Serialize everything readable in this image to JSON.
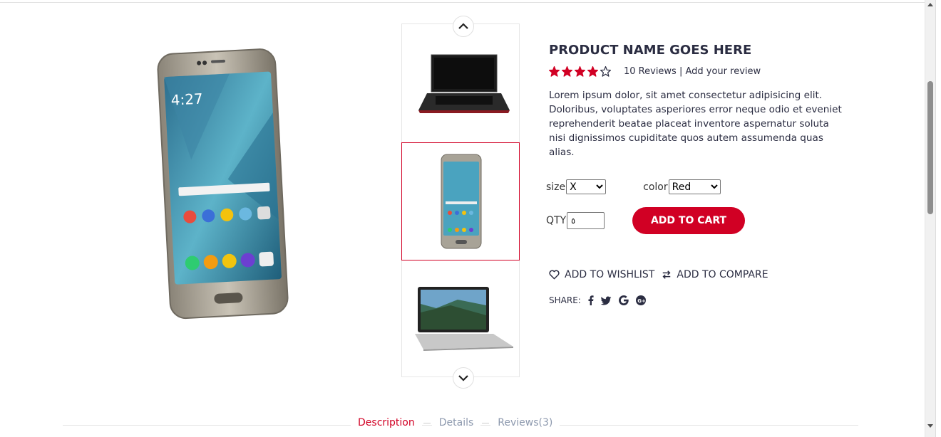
{
  "product": {
    "title": "PRODUCT NAME GOES HERE",
    "rating": 4,
    "rating_max": 5,
    "reviews_text": "10 Reviews | Add your review",
    "description": "Lorem ipsum dolor, sit amet consectetur adipisicing elit. Doloribus, voluptates asperiores error neque odio et eveniet reprehenderit beatae placeat inventore aspernatur soluta nisi dignissimos cupiditate quos autem assumenda quas alias."
  },
  "options": {
    "size_label": "size",
    "size_value": "X",
    "color_label": "color",
    "color_value": "Red",
    "qty_label": "QTY",
    "qty_value": "٥"
  },
  "actions": {
    "add_to_cart": "ADD TO CART",
    "add_to_wishlist": "ADD TO WISHLIST",
    "add_to_compare": "ADD TO COMPARE",
    "share_label": "SHARE:"
  },
  "share_icons": [
    "facebook-icon",
    "twitter-icon",
    "google-icon",
    "google-plus-icon"
  ],
  "thumbnails": [
    "laptop-black",
    "phone",
    "macbook"
  ],
  "tabs": [
    {
      "label": "Description",
      "active": true
    },
    {
      "label": "Details",
      "active": false
    },
    {
      "label": "Reviews(3)",
      "active": false
    }
  ],
  "colors": {
    "accent": "#d10024",
    "text": "#2b2d42",
    "muted": "#8d99ae"
  }
}
